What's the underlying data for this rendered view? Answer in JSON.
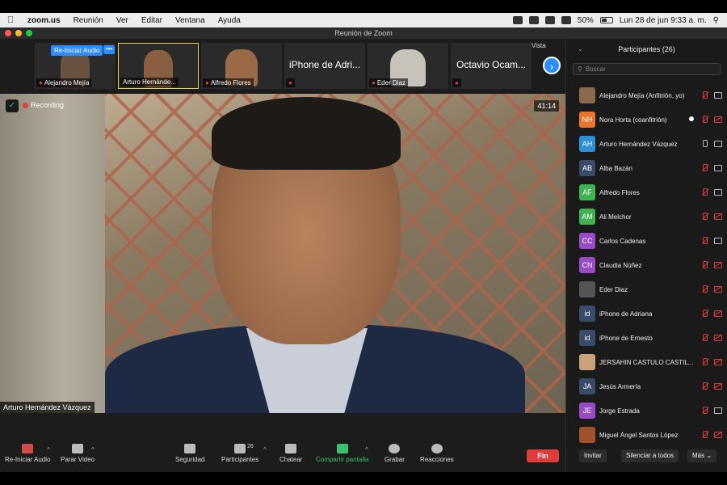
{
  "menubar": {
    "app": "zoom.us",
    "items": [
      "Reunión",
      "Ver",
      "Editar",
      "Ventana",
      "Ayuda"
    ],
    "battery": "50%",
    "datetime": "Lun 28 de jun  9:33 a. m."
  },
  "window": {
    "title": "Reunión de Zoom"
  },
  "gallery": {
    "reaudio_label": "Re-Iniciar Audio",
    "dots_label": "•••",
    "vista_label": "Vista",
    "tiles": [
      {
        "name": "Alejandro Mejía",
        "muted": true
      },
      {
        "name": "Arturo Hernánde...",
        "muted": false
      },
      {
        "name": "Alfredo Flores",
        "muted": true
      },
      {
        "name": "iPhone de Adri...",
        "muted": true,
        "text_only": true
      },
      {
        "name": "Eder Diaz",
        "muted": true
      },
      {
        "name": "Octavio Ocam...",
        "muted": true,
        "text_only": true
      }
    ]
  },
  "video": {
    "recording_label": "Recording",
    "timer": "41:14",
    "speaker": "Arturo Hernández Vázquez"
  },
  "toolbar": {
    "reaudio": "Re-Iniciar Audio",
    "video": "Parar Video",
    "security": "Seguridad",
    "participants": "Participantes",
    "participants_count": "26",
    "chat": "Chatear",
    "share": "Compartir pantalla",
    "record": "Grabar",
    "reactions": "Reacciones",
    "end": "Fin"
  },
  "panel": {
    "title": "Participantes (26)",
    "search_placeholder": "Buscar",
    "participants": [
      {
        "initials": "",
        "name": "Alejandro Mejía (Anfitrión, yo)",
        "color": "#8a6a4a",
        "mic": "off",
        "cam": "on",
        "photo": true
      },
      {
        "initials": "NH",
        "name": "Nora Horta (coanfitrión)",
        "color": "#e8742e",
        "mic": "off",
        "cam": "off",
        "record": true
      },
      {
        "initials": "AH",
        "name": "Arturo Hernández Vázquez",
        "color": "#2e8fd6",
        "mic": "on",
        "cam": "on"
      },
      {
        "initials": "AB",
        "name": "Alba Bazán",
        "color": "#3a4a6a",
        "mic": "off",
        "cam": "on"
      },
      {
        "initials": "AF",
        "name": "Alfredo Flores",
        "color": "#3fb34f",
        "mic": "off",
        "cam": "on"
      },
      {
        "initials": "AM",
        "name": "Ali Melchor",
        "color": "#3fb34f",
        "mic": "off",
        "cam": "off"
      },
      {
        "initials": "CC",
        "name": "Carlos Cadenas",
        "color": "#9a4ac7",
        "mic": "off",
        "cam": "on"
      },
      {
        "initials": "CN",
        "name": "Claudia Núñez",
        "color": "#9a4ac7",
        "mic": "off",
        "cam": "off"
      },
      {
        "initials": "",
        "name": "Eder Diaz",
        "color": "#555555",
        "mic": "off",
        "cam": "off",
        "photo": true
      },
      {
        "initials": "id",
        "name": "iPhone de Adriana",
        "color": "#3a4a6a",
        "mic": "off",
        "cam": "off"
      },
      {
        "initials": "id",
        "name": "iPhone de Ernesto",
        "color": "#3a4a6a",
        "mic": "off",
        "cam": "off"
      },
      {
        "initials": "",
        "name": "JERSAHIN CASTULO CASTIL...",
        "color": "#c9a27a",
        "mic": "off",
        "cam": "off",
        "photo": true
      },
      {
        "initials": "JA",
        "name": "Jesús Armería",
        "color": "#3a4a6a",
        "mic": "off",
        "cam": "off"
      },
      {
        "initials": "JE",
        "name": "Jorge Estrada",
        "color": "#9a4ac7",
        "mic": "off",
        "cam": "on"
      },
      {
        "initials": "",
        "name": "Miguel Ángel Santos López",
        "color": "#a0522d",
        "mic": "off",
        "cam": "off",
        "photo": true
      }
    ],
    "invite": "Invitar",
    "mute_all": "Silenciar a todos",
    "more": "Más"
  }
}
